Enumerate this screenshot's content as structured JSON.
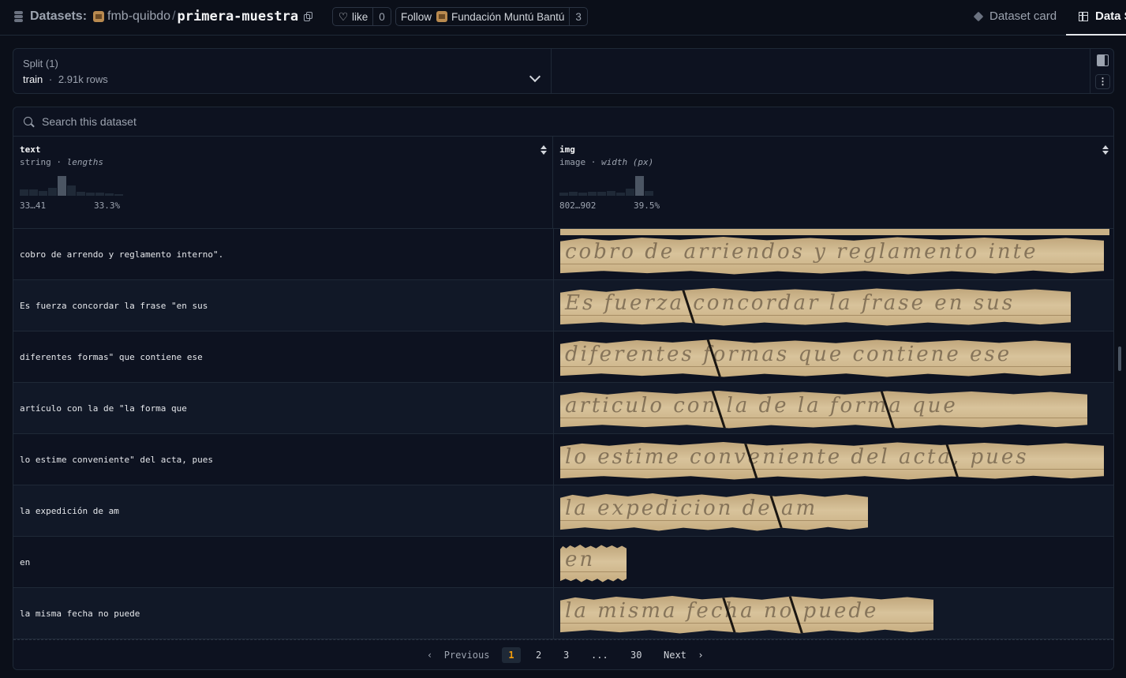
{
  "header": {
    "datasets_label": "Datasets:",
    "org": "fmb-quibdo",
    "separator": "/",
    "repo": "primera-muestra",
    "like_label": "like",
    "like_count": "0",
    "follow_label": "Follow",
    "follow_org": "Fundación Muntú Bantú",
    "follow_count": "3",
    "tabs": [
      {
        "label": "Dataset card",
        "icon": "cube-icon",
        "active": false
      },
      {
        "label": "Data S",
        "icon": "table-icon",
        "active": true
      }
    ]
  },
  "split": {
    "title": "Split (1)",
    "value": "train",
    "separator": "·",
    "rows": "2.91k rows"
  },
  "search": {
    "placeholder": "Search this dataset"
  },
  "columns": [
    {
      "name": "text",
      "type": "string",
      "stat": "lengths",
      "range_label": "33…41",
      "pct_label": "33.3%",
      "histogram": [
        0.3,
        0.3,
        0.25,
        0.4,
        1.0,
        0.5,
        0.2,
        0.15,
        0.15,
        0.1,
        0.05
      ],
      "highlight_index": 4
    },
    {
      "name": "img",
      "type": "image",
      "stat": "width (px)",
      "range_label": "802…902",
      "pct_label": "39.5%",
      "histogram": [
        0.15,
        0.2,
        0.15,
        0.2,
        0.2,
        0.25,
        0.15,
        0.35,
        1.0,
        0.25
      ],
      "highlight_index": 8
    }
  ],
  "rows": [
    {
      "text": "cobro de arrendo y reglamento interno\".",
      "img_ink": "cobro de arriendos y reglamento inte",
      "img_width": 0.99
    },
    {
      "text": "Es fuerza concordar la frase \"en sus",
      "img_ink": "Es fuerza concordar la frase en sus",
      "img_width": 0.93
    },
    {
      "text": "diferentes formas\" que contiene ese",
      "img_ink": "diferentes formas que contiene ese",
      "img_width": 0.93
    },
    {
      "text": "artículo con la de \"la forma que",
      "img_ink": "articulo con la de la forma que",
      "img_width": 0.96
    },
    {
      "text": "lo estime conveniente\" del acta, pues",
      "img_ink": "lo estime conveniente del acta, pues",
      "img_width": 0.99
    },
    {
      "text": "la expedición de am",
      "img_ink": "la expedicion de am",
      "img_width": 0.56
    },
    {
      "text": "en",
      "img_ink": "en",
      "img_width": 0.12
    },
    {
      "text": "la misma fecha no puede",
      "img_ink": "la misma fecha no puede",
      "img_width": 0.68
    }
  ],
  "pagination": {
    "previous": "Previous",
    "pages": [
      "1",
      "2",
      "3",
      "...",
      "30"
    ],
    "current": "1",
    "next": "Next"
  }
}
